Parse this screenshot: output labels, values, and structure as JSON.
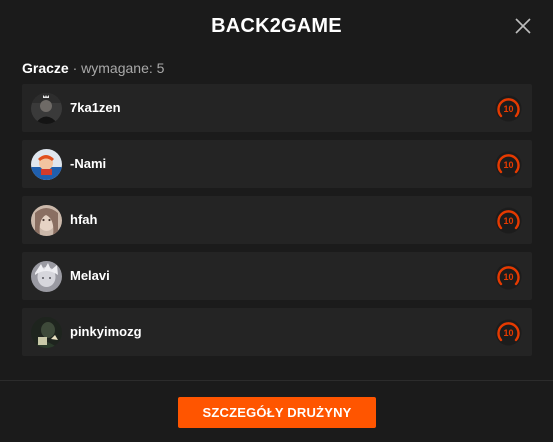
{
  "modal": {
    "title": "BACK2GAME",
    "close_icon": "close-icon"
  },
  "players_section": {
    "label": "Gracze",
    "separator": " · ",
    "required_text": "wymagane: 5"
  },
  "players": [
    {
      "name": "7ka1zen",
      "level": "10",
      "avatar": "avatar-7ka1zen"
    },
    {
      "name": "-Nami",
      "level": "10",
      "avatar": "avatar-nami"
    },
    {
      "name": "hfah",
      "level": "10",
      "avatar": "avatar-hfah"
    },
    {
      "name": "Melavi",
      "level": "10",
      "avatar": "avatar-melavi"
    },
    {
      "name": "pinkyimozg",
      "level": "10",
      "avatar": "avatar-pinkyimozg"
    }
  ],
  "footer": {
    "team_details_button": "SZCZEGÓŁY DRUŻYNY"
  },
  "colors": {
    "background": "#1b1b1b",
    "row_background": "#242424",
    "accent": "#ff5500",
    "level_ring": "#e63a00"
  }
}
